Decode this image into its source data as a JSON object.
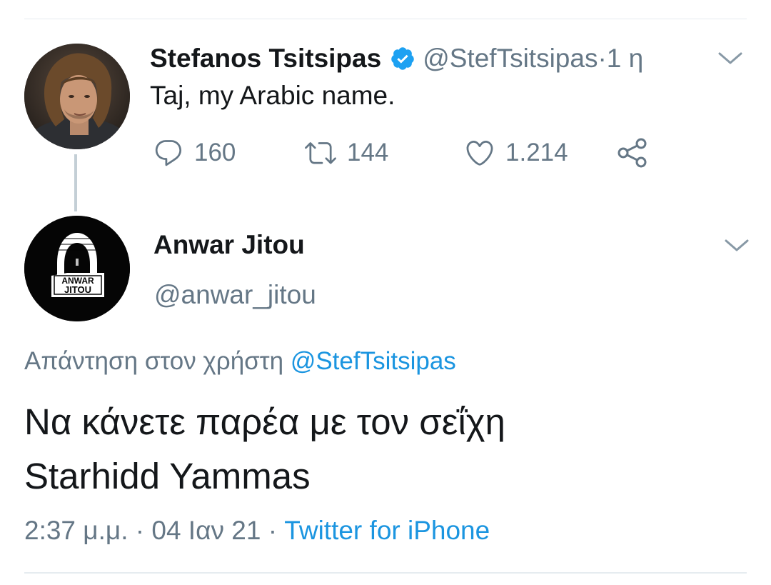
{
  "parent_tweet": {
    "display_name": "Stefanos Tsitsipas",
    "handle": "@StefTsitsipas",
    "time_separator": " · ",
    "time": "1 η",
    "text": "Taj, my Arabic name.",
    "verified": true,
    "avatar_icon": "profile-photo",
    "actions": {
      "reply_count": "160",
      "retweet_count": "144",
      "like_count": "1.214",
      "reply_icon": "speech-bubble-icon",
      "retweet_icon": "retweet-icon",
      "like_icon": "heart-icon",
      "share_icon": "share-icon"
    }
  },
  "reply_tweet": {
    "display_name": "Anwar Jitou",
    "handle": "@anwar_jitou",
    "avatar_text_line1": "ANWAR",
    "avatar_text_line2": "JITOU",
    "replying_to_prefix": "Απάντηση στον χρήστη ",
    "replying_to_handle": "@StefTsitsipas",
    "text_line1": "Να κάνετε παρέα με τον σεΐχη",
    "text_line2": "Starhidd Yammas",
    "timestamp": "2:37 μ.μ. · 04 Ιαν 21 · ",
    "source": "Twitter for iPhone"
  },
  "colors": {
    "link": "#1b95e0",
    "secondary_text": "#657786",
    "primary_text": "#14171a",
    "divider": "#e6ecf0",
    "thread_line": "#c4cfd6"
  }
}
